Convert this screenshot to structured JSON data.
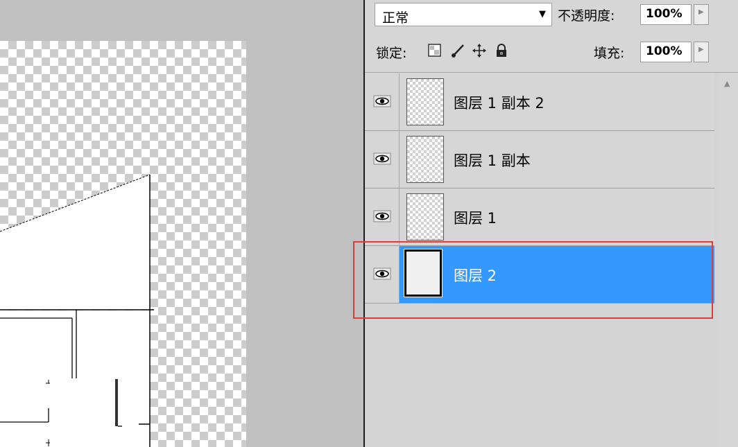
{
  "blend": {
    "mode_value": "正常",
    "opacity_label": "不透明度:",
    "opacity_value": "100%"
  },
  "lock": {
    "label": "锁定:",
    "icons": [
      "lock-transparent-pixels-icon",
      "lock-image-pixels-icon",
      "lock-position-icon",
      "lock-all-icon"
    ],
    "fill_label": "填充:",
    "fill_value": "100%"
  },
  "layers": [
    {
      "name": "图层 1 副本 2",
      "visible": true,
      "selected": false
    },
    {
      "name": "图层 1 副本",
      "visible": true,
      "selected": false
    },
    {
      "name": "图层 1",
      "visible": true,
      "selected": false
    },
    {
      "name": "图层 2",
      "visible": true,
      "selected": true
    }
  ],
  "colors": {
    "selected_row": "#3399ff",
    "annotation_box": "#e53935",
    "panel_bg": "#d6d6d6",
    "canvas_bg": "#c0c0c0"
  }
}
